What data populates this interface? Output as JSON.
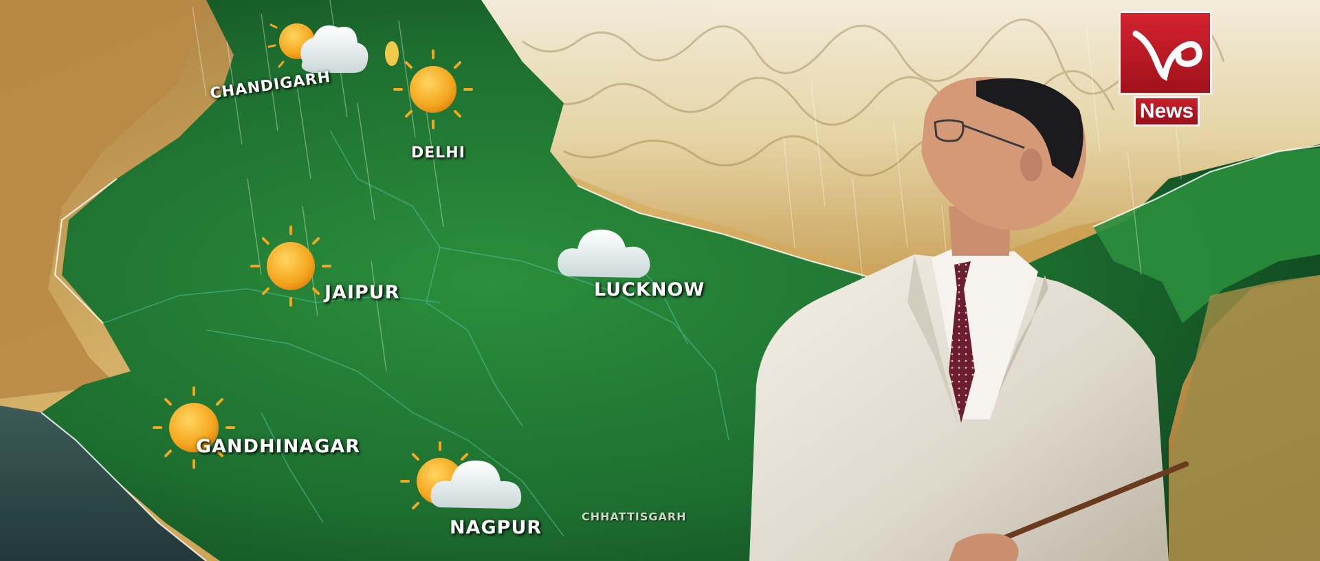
{
  "broadcast": {
    "channel_label": "News",
    "logo_mark": "VC"
  },
  "cities": {
    "chandigarh": "CHANDIGARH",
    "delhi": "DELHI",
    "jaipur": "JAIPUR",
    "lucknow": "LUCKNOW",
    "gandhinagar": "GANDHINAGAR",
    "nagpur": "NAGPUR"
  },
  "regions": {
    "chhattisgarh": "CHHATTISGARH"
  },
  "weather_icons": {
    "chandigarh": "sun-behind-cloud-icon",
    "delhi": "sun-icon",
    "jaipur": "sun-icon",
    "lucknow": "cloud-icon",
    "gandhinagar": "sun-icon",
    "nagpur": "sun-behind-cloud-icon"
  },
  "colors": {
    "map_green": "#1f7a33",
    "terrain_tan": "#c9a55a",
    "sun_orange": "#f5a71f",
    "cloud_white": "#eef3f3",
    "logo_red": "#c81f2a",
    "suit_white": "#e9e4da",
    "tie_maroon": "#6b1f2e"
  }
}
